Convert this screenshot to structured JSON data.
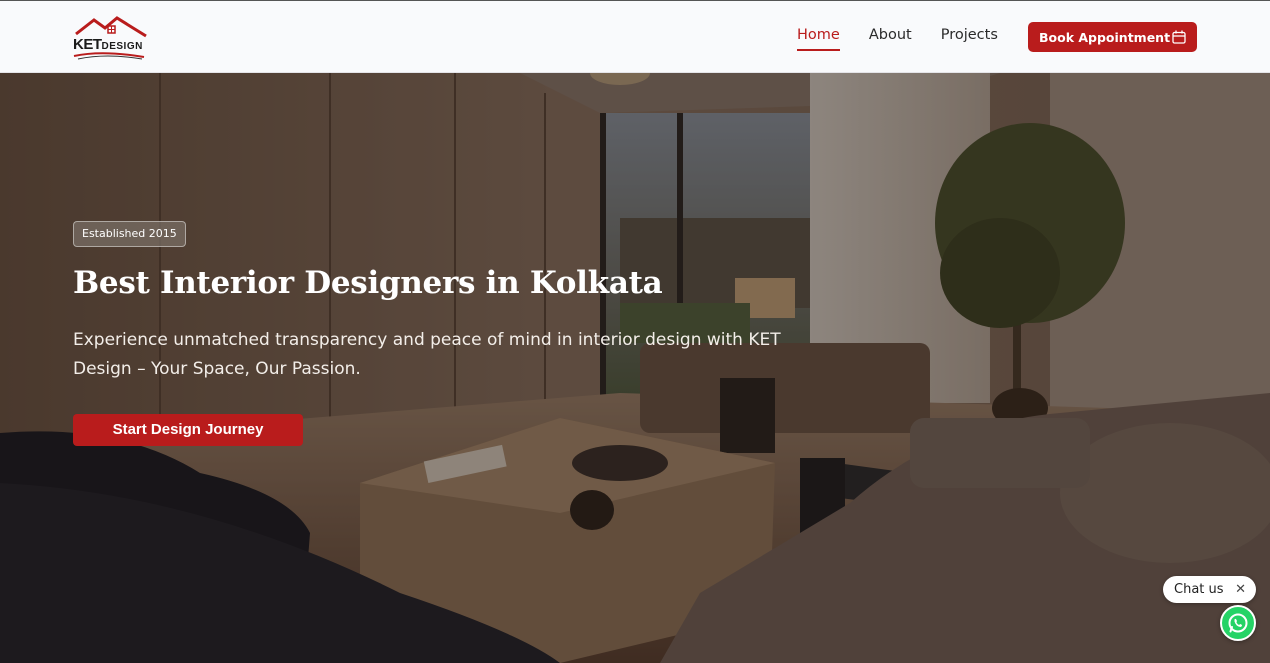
{
  "brand": {
    "logo_ket": "KET",
    "logo_design": "DESIGN",
    "accent": "#b91c1c"
  },
  "nav": {
    "items": [
      {
        "label": "Home",
        "active": true
      },
      {
        "label": "About",
        "active": false
      },
      {
        "label": "Projects",
        "active": false
      }
    ],
    "book_label": "Book Appointment",
    "book_icon": "calendar-icon"
  },
  "hero": {
    "badge": "Established 2015",
    "title": "Best Interior Designers in Kolkata",
    "subtitle": "Experience unmatched transparency and peace of mind in interior design with KET Design – Your Space, Our Passion.",
    "cta_label": "Start Design Journey"
  },
  "chat": {
    "label": "Chat us",
    "close_icon": "close-icon",
    "whatsapp_icon": "whatsapp-icon"
  }
}
